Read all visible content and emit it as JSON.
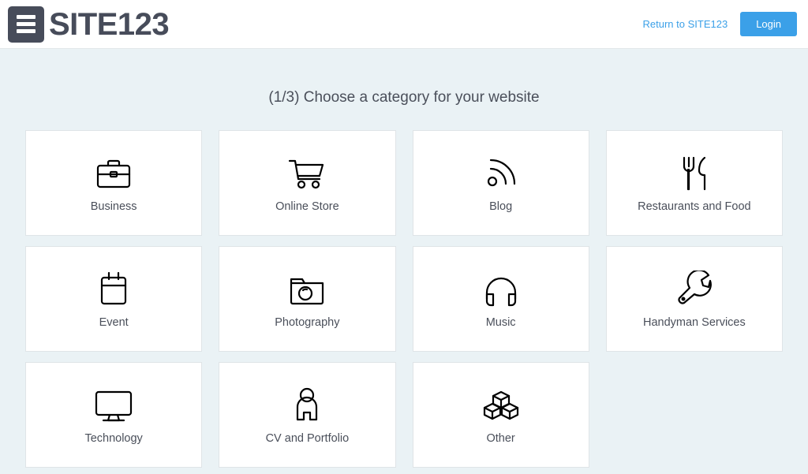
{
  "header": {
    "logo_icon": "hamburger-mark-icon",
    "brand_name": "SITE123",
    "return_link_label": "Return to SITE123",
    "login_button_label": "Login",
    "accent_color": "#3ba0e8",
    "brand_color": "#474c5a"
  },
  "main": {
    "page_title": "(1/3) Choose a category for your website",
    "background_color": "#eaf2f5",
    "categories": [
      {
        "label": "Business",
        "icon": "briefcase-icon"
      },
      {
        "label": "Online Store",
        "icon": "shopping-cart-icon"
      },
      {
        "label": "Blog",
        "icon": "rss-feed-icon"
      },
      {
        "label": "Restaurants and Food",
        "icon": "fork-and-knife-icon"
      },
      {
        "label": "Event",
        "icon": "calendar-icon"
      },
      {
        "label": "Photography",
        "icon": "camera-icon"
      },
      {
        "label": "Music",
        "icon": "headphones-icon"
      },
      {
        "label": "Handyman Services",
        "icon": "wrench-icon"
      },
      {
        "label": "Technology",
        "icon": "desktop-monitor-icon"
      },
      {
        "label": "CV and Portfolio",
        "icon": "person-icon"
      },
      {
        "label": "Other",
        "icon": "cubes-icon"
      }
    ]
  }
}
